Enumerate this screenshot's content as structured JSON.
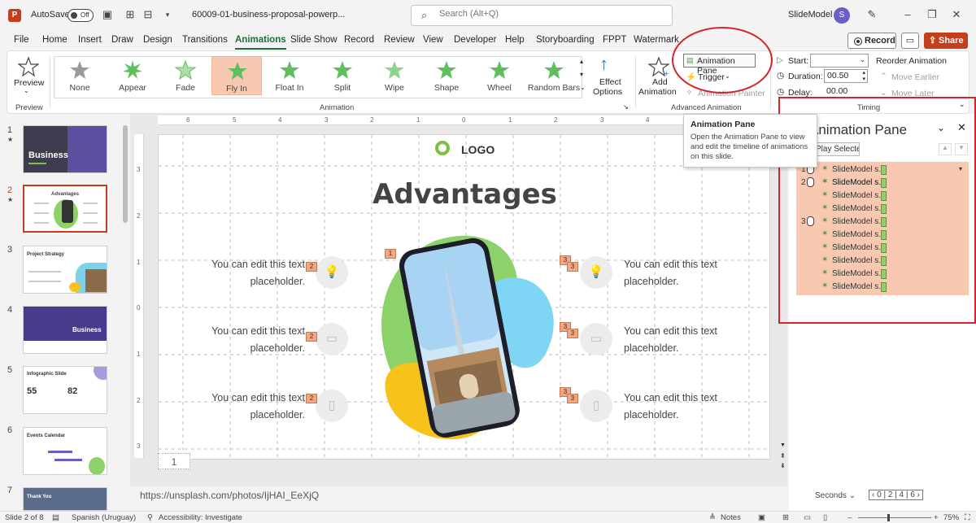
{
  "titlebar": {
    "app_letter": "P",
    "autosave_label": "AutoSave",
    "autosave_state": "Off",
    "file_name": "60009-01-business-proposal-powerp...",
    "search_placeholder": "Search (Alt+Q)",
    "user_name": "SlideModel",
    "avatar_letter": "S"
  },
  "tabs": [
    "File",
    "Home",
    "Insert",
    "Draw",
    "Design",
    "Transitions",
    "Animations",
    "Slide Show",
    "Record",
    "Review",
    "View",
    "Developer",
    "Help",
    "Storyboarding",
    "FPPT",
    "Watermark"
  ],
  "active_tab": "Animations",
  "actions": {
    "record": "Record",
    "share": "Share"
  },
  "ribbon": {
    "preview": "Preview",
    "preview_group": "Preview",
    "animations": [
      "None",
      "Appear",
      "Fade",
      "Fly In",
      "Float In",
      "Split",
      "Wipe",
      "Shape",
      "Wheel",
      "Random Bars"
    ],
    "selected_animation": "Fly In",
    "animation_group": "Animation",
    "effect_options": [
      "Effect",
      "Options"
    ],
    "add_animation": [
      "Add",
      "Animation"
    ],
    "animation_pane": "Animation Pane",
    "trigger": "Trigger",
    "animation_painter": "Animation Painter",
    "advanced_group": "Advanced Animation",
    "start_label": "Start:",
    "duration_label": "Duration:",
    "duration_value": "00.50",
    "delay_label": "Delay:",
    "delay_value": "00.00",
    "timing_group": "Timing",
    "reorder": "Reorder Animation",
    "move_earlier": "Move Earlier",
    "move_later": "Move Later"
  },
  "thumbnails": [
    {
      "num": "1",
      "title": "Business"
    },
    {
      "num": "2",
      "title": "Advantages"
    },
    {
      "num": "3",
      "title": "Project Strategy"
    },
    {
      "num": "4",
      "title": "Business"
    },
    {
      "num": "5",
      "title": "Infographic Slide"
    },
    {
      "num": "6",
      "title": "Events Calendar"
    },
    {
      "num": "7",
      "title": "Thank You"
    }
  ],
  "slide": {
    "logo": "LOGO",
    "title": "Advantages",
    "placeholder_line1": "You can edit this text",
    "placeholder_line2": "placeholder.",
    "tags": {
      "center": "1",
      "left": "2",
      "right": "3"
    },
    "slide_number": "1"
  },
  "ruler": {
    "h_ticks": [
      "6",
      "5",
      "4",
      "3",
      "2",
      "1",
      "0",
      "1",
      "2",
      "3",
      "4",
      "5",
      "6"
    ],
    "v_ticks": [
      "3",
      "2",
      "1",
      "0",
      "1",
      "2",
      "3"
    ]
  },
  "url_note": "https://unsplash.com/photos/IjHAI_EeXjQ",
  "tooltip": {
    "title": "Animation Pane",
    "desc": "Open the Animation Pane to view and edit the timeline of animations on this slide."
  },
  "pane": {
    "title": "Animation Pane",
    "play": "Play Selected",
    "item_label": "SlideModel s...",
    "rows": [
      {
        "n": "1",
        "mouse": true
      },
      {
        "n": "",
        "mouse": false
      },
      {
        "n": "2",
        "mouse": true
      },
      {
        "n": "",
        "mouse": false
      },
      {
        "n": "",
        "mouse": false
      },
      {
        "n": "3",
        "mouse": true
      },
      {
        "n": "",
        "mouse": false
      },
      {
        "n": "",
        "mouse": false
      },
      {
        "n": "",
        "mouse": false
      },
      {
        "n": "",
        "mouse": false
      }
    ],
    "seconds": "Seconds",
    "timeline_ticks": [
      "0",
      "2",
      "4",
      "6"
    ]
  },
  "statusbar": {
    "slide_info": "Slide 2 of 8",
    "language": "Spanish (Uruguay)",
    "accessibility": "Accessibility: Investigate",
    "notes": "Notes",
    "zoom": "75%"
  },
  "colors": {
    "accent": "#c43e1c",
    "active_tab": "#1e6e3a",
    "highlight": "#f8c8b1",
    "annotation": "#d6242a"
  }
}
